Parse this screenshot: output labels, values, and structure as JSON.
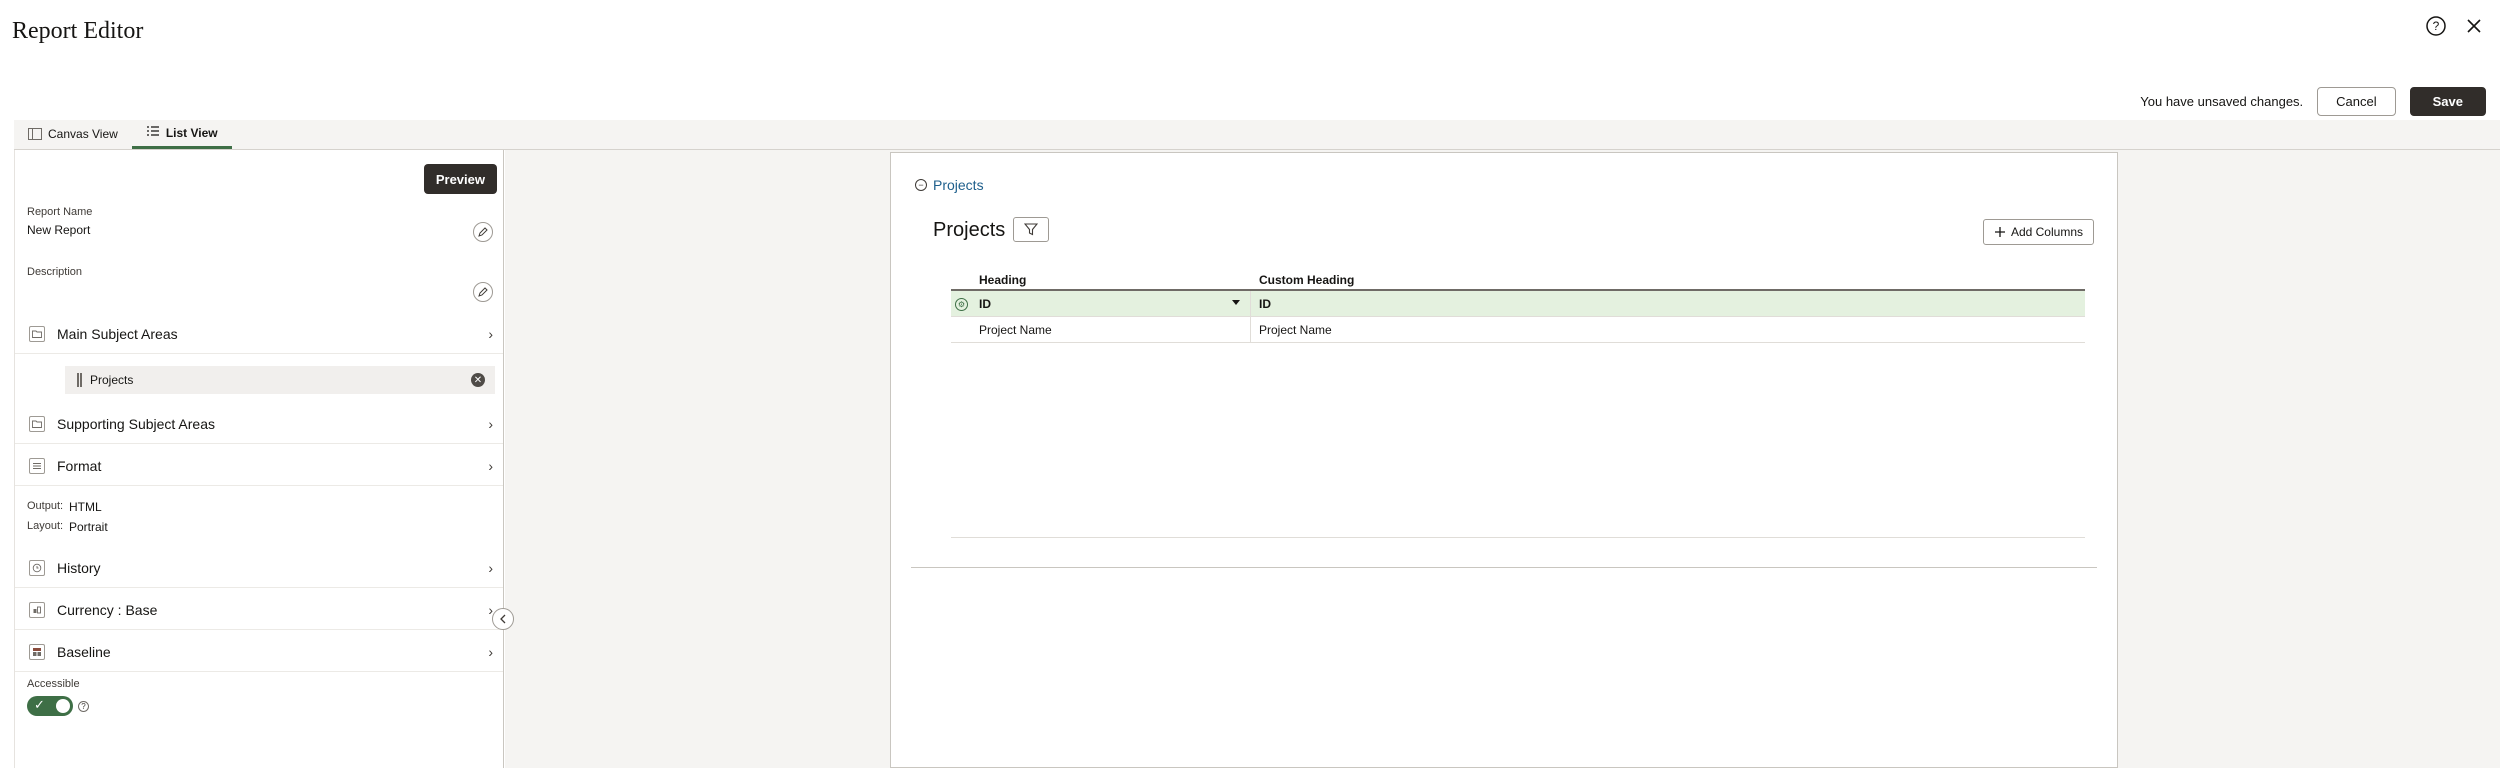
{
  "window": {
    "title": "Report Editor"
  },
  "header_icons": {
    "help": "help-icon",
    "close": "close-icon"
  },
  "actions": {
    "unsaved": "You have unsaved changes.",
    "cancel": "Cancel",
    "save": "Save"
  },
  "tabs": [
    {
      "label": "Canvas View",
      "active": false
    },
    {
      "label": "List View",
      "active": true
    }
  ],
  "left_panel": {
    "preview": "Preview",
    "report_name_label": "Report Name",
    "report_name_value": "New Report",
    "description_label": "Description",
    "sections": {
      "main": "Main Subject Areas",
      "supporting": "Supporting Subject Areas",
      "format": "Format",
      "history": "History",
      "currency": "Currency : Base",
      "baseline": "Baseline"
    },
    "main_chip": "Projects",
    "output_label": "Output:",
    "output_value": "HTML",
    "layout_label": "Layout:",
    "layout_value": "Portrait",
    "accessible_label": "Accessible",
    "accessible_on": true
  },
  "canvas": {
    "subject_link": "Projects",
    "title": "Projects",
    "add_columns": "Add Columns",
    "grid": {
      "headers": [
        "Heading",
        "Custom Heading"
      ],
      "rows": [
        {
          "heading": "ID",
          "custom": "ID",
          "selected": true
        },
        {
          "heading": "Project Name",
          "custom": "Project Name",
          "selected": false
        }
      ]
    }
  },
  "colors": {
    "accent": "#3e6f46",
    "primary_button": "#312d2a",
    "selected_row": "#e4f1df"
  }
}
